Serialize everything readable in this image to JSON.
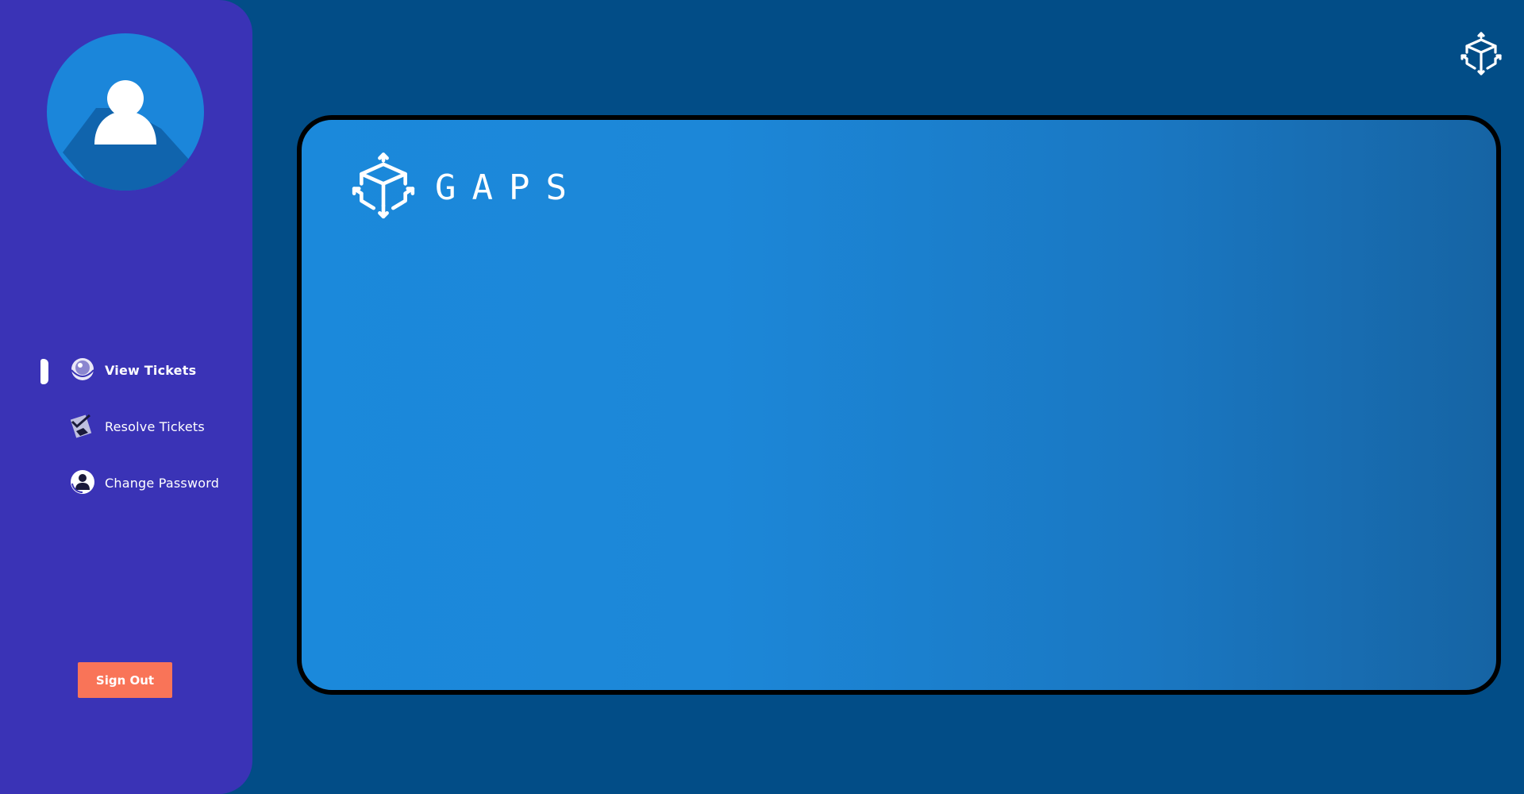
{
  "sidebar": {
    "avatar_icon": "user-avatar-icon",
    "nav": [
      {
        "label": "View Tickets",
        "icon": "eye-icon",
        "active": true
      },
      {
        "label": "Resolve Tickets",
        "icon": "checklist-icon",
        "active": false
      },
      {
        "label": "Change Password",
        "icon": "user-lock-icon",
        "active": false
      }
    ],
    "signout_label": "Sign Out"
  },
  "header": {
    "logo_icon": "cube-logo-icon"
  },
  "card": {
    "brand": "GAPS",
    "logo_icon": "cube-logo-icon"
  },
  "colors": {
    "background": "#024d87",
    "sidebar": "#3a33b6",
    "avatar": "#1b86da",
    "signout": "#f97458",
    "card_gradient_start": "#1b89db",
    "card_gradient_end": "#1664a4"
  }
}
